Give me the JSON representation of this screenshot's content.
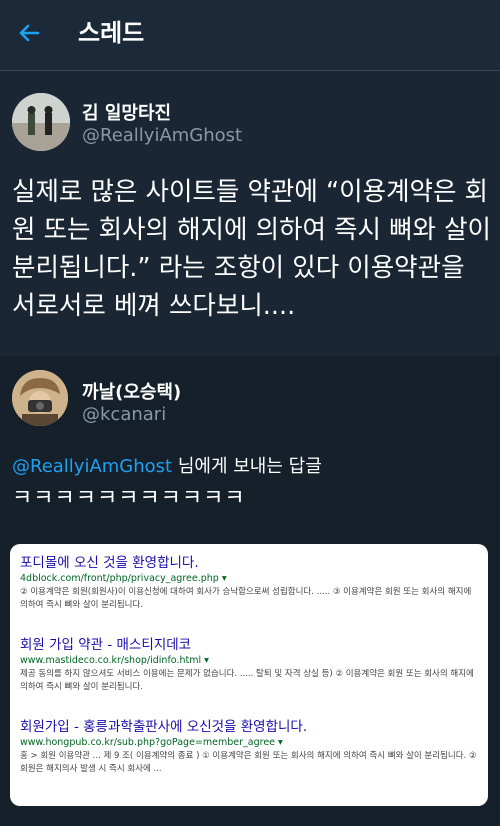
{
  "header": {
    "title": "스레드"
  },
  "tweet1": {
    "name": "김 일망타진",
    "handle": "@ReallyiAmGhost",
    "text": "실제로 많은 사이트들 약관에 “이용계약은 회원 또는 회사의 해지에 의하여 즉시 뼈와 살이 분리됩니다.” 라는 조항이 있다 이용약관을 서로서로 베껴 쓰다보니...."
  },
  "tweet2": {
    "name": "까날(오승택)",
    "handle": "@kcanari",
    "reply_mention": "@ReallyiAmGhost",
    "reply_rest": " 님에게 보내는 답글",
    "body": "ㅋㅋㅋㅋㅋㅋㅋㅋㅋㅋㅋ",
    "results": [
      {
        "title": "포디몰에 오신 것을 환영합니다.",
        "url": "4dblock.com/front/php/privacy_agree.php",
        "snippet": "② 이용계약은 회원(회원사)이 이용신청에 대하여 회사가 승낙함으로써 성립합니다. ..... ③ 이용계약은 회원 또는 회사의 해지에 의하여 즉시 뼈와 살이 분리됩니다."
      },
      {
        "title": "회원 가입 약관 - 매스티지데코",
        "url": "www.mastideco.co.kr/shop/idinfo.html",
        "snippet": "제공 동의를 하지 않으셔도 서비스 이용에는 문제가 없습니다. ..... 탈퇴 및 자격 상실 등) ② 이용계약은 회원 또는 회사의 해지에 의하여 즉시 뼈와 살이 분리됩니다."
      },
      {
        "title": "회원가입 - 홍릉과학출판사에 오신것을 환영합니다.",
        "url": "www.hongpub.co.kr/sub.php?goPage=member_agree",
        "snippet": "홍 > 회원 이용약관 ... 제 9 조( 이용계약의 종료 ) ① 이용계약은 회원 또는 회사의 해지에 의하여 즉시 뼈와 살이 분리됩니다. ② 회원은 해지의사 발생 시 즉시 회사에 ..."
      }
    ]
  },
  "colors": {
    "background": "#15202b",
    "accent": "#1da1f2",
    "muted": "#8899a6",
    "link": "#1a0dab",
    "url": "#006621"
  }
}
